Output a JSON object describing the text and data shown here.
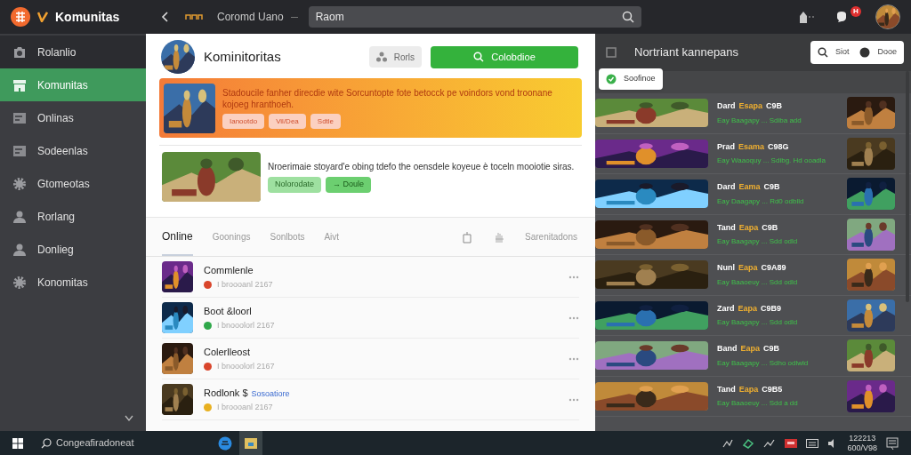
{
  "topbar": {
    "app_title": "Komunitas",
    "breadcrumb": "Coromd Uano",
    "search": {
      "value": "Raom"
    },
    "notification_badge": "H"
  },
  "sidebar": {
    "items": [
      {
        "label": "Rolanlio",
        "kind": "camera",
        "selected": false
      },
      {
        "label": "Komunitas",
        "kind": "store",
        "selected": true
      },
      {
        "label": "Onlinas",
        "kind": "card",
        "selected": false
      },
      {
        "label": "Sodeenlas",
        "kind": "card",
        "selected": false
      },
      {
        "label": "Gtomeotas",
        "kind": "gear",
        "selected": false
      },
      {
        "label": "Rorlang",
        "kind": "person",
        "selected": false
      },
      {
        "label": "Donlieg",
        "kind": "person",
        "selected": false
      },
      {
        "label": "Konomitas",
        "kind": "gear",
        "selected": false
      }
    ]
  },
  "community": {
    "title": "Kominitoritas",
    "share_button": "Rorls",
    "join_button": "Colobdioe",
    "banner": {
      "text": "Stadoucile fanher direcdie wite Sorcuntopte fote betocck pe voindors vond troonane kojoeg hranthoeh.",
      "buttons": [
        "Ianootdo",
        "Vil/Dea",
        "Sdtle"
      ]
    },
    "post": {
      "text": "Nroerimaie stoyard'e obing tdefo the oensdele koyeue è toceln mooiotie siras.",
      "buttons": [
        {
          "label": "Nolorodate",
          "kind": "light"
        },
        {
          "label": "→ Doule",
          "kind": "strong"
        }
      ]
    },
    "tabs": [
      {
        "label": "Online",
        "selected": true
      },
      {
        "label": "Goonings",
        "selected": false
      },
      {
        "label": "Sonlbots",
        "selected": false
      },
      {
        "label": "Aivt",
        "selected": false
      }
    ],
    "tab_action": "Sarenitadons",
    "members": [
      {
        "name": "Commlenle",
        "status": "I broooanl 2167",
        "color": "#d9452b"
      },
      {
        "name": "Boot &loorl",
        "status": "I bnooolorl 2167",
        "color": "#2fa84a"
      },
      {
        "name": "Colerlleost",
        "status": "I bnooolorl 2167",
        "color": "#d9452b"
      },
      {
        "name": "Rodlonk $",
        "link": "Sosoatiore",
        "status": "I broooanl 2167",
        "color": "#e8b020"
      }
    ]
  },
  "games_panel": {
    "title": "Nortriant kannepans",
    "sort": "Siot",
    "done": "Dooe",
    "toast": "Soofinoe",
    "games": [
      {
        "name": "Dard",
        "tag": "Esapa",
        "code": "C9B",
        "detail": "Eay Baagapy ... Sdiba add"
      },
      {
        "name": "Prad",
        "tag": "Esama",
        "code": "C98G",
        "detail": "Eay Waaoquy ... Sdibg. Hd ooadla"
      },
      {
        "name": "Dard",
        "tag": "Eama",
        "code": "C9B",
        "detail": "Eay Daagapy ... Rd0 odblld"
      },
      {
        "name": "Tand",
        "tag": "Eapa",
        "code": "C9B",
        "detail": "Eay Baagapy ... Sdd odld"
      },
      {
        "name": "Nunl",
        "tag": "Eapa",
        "code": "C9A89",
        "detail": "Eay Baaoeuy ... Sdd odld"
      },
      {
        "name": "Zard",
        "tag": "Eapa",
        "code": "C9B9",
        "detail": "Eay Baagapy ... Sdd odld"
      },
      {
        "name": "Band",
        "tag": "Eapa",
        "code": "C9B",
        "detail": "Eay Baagapy ... Sdho odlwld"
      },
      {
        "name": "Tand",
        "tag": "Eapa",
        "code": "C9B5",
        "detail": "Eay Baaoeuy ... Sdd a dd"
      }
    ]
  },
  "taskbar": {
    "search": "Congeafiradoneat",
    "time": "122213",
    "date": "600/V98"
  }
}
